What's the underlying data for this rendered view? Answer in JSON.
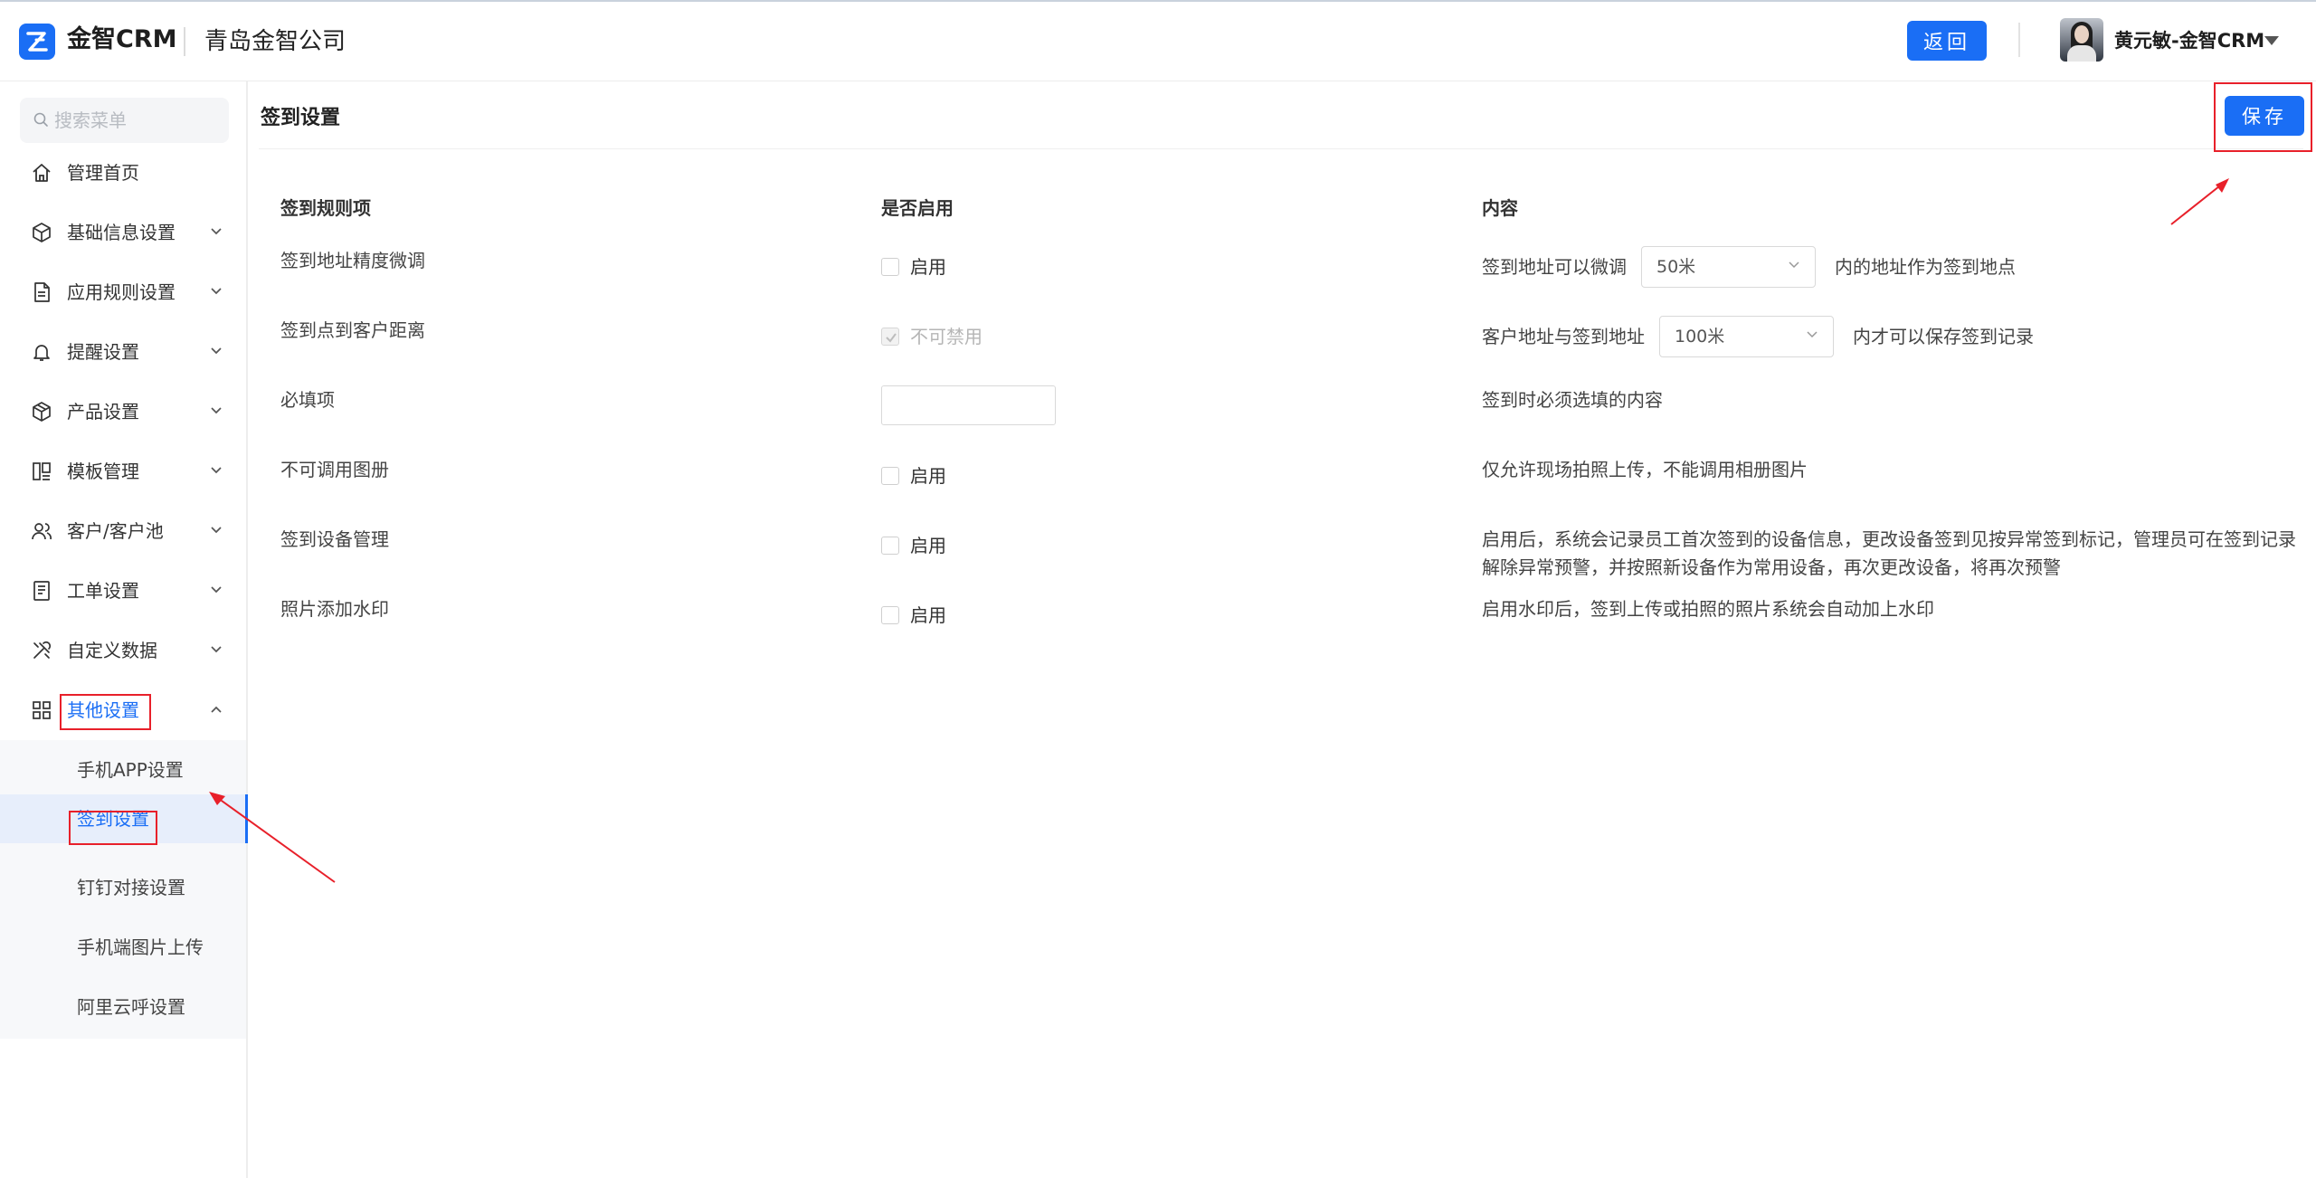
{
  "header": {
    "brand": "金智CRM",
    "company": "青岛金智公司",
    "back_label": "返回",
    "user_name": "黄元敏-金智CRM"
  },
  "sidebar": {
    "search_placeholder": "搜索菜单",
    "items": [
      {
        "label": "管理首页",
        "icon": "home-icon"
      },
      {
        "label": "基础信息设置",
        "icon": "cube-icon"
      },
      {
        "label": "应用规则设置",
        "icon": "document-icon"
      },
      {
        "label": "提醒设置",
        "icon": "bell-icon"
      },
      {
        "label": "产品设置",
        "icon": "box-icon"
      },
      {
        "label": "模板管理",
        "icon": "template-icon"
      },
      {
        "label": "客户/客户池",
        "icon": "users-icon"
      },
      {
        "label": "工单设置",
        "icon": "ticket-icon"
      },
      {
        "label": "自定义数据",
        "icon": "tools-icon"
      },
      {
        "label": "其他设置",
        "icon": "grid-icon"
      }
    ],
    "subitems": [
      {
        "label": "手机APP设置"
      },
      {
        "label": "签到设置"
      },
      {
        "label": "钉钉对接设置"
      },
      {
        "label": "手机端图片上传"
      },
      {
        "label": "阿里云呼设置"
      }
    ]
  },
  "main": {
    "title": "签到设置",
    "save_label": "保存",
    "columns": {
      "rule": "签到规则项",
      "enabled": "是否启用",
      "content": "内容"
    },
    "rows": [
      {
        "rule": "签到地址精度微调",
        "toggle": "启用",
        "content_prefix": "签到地址可以微调",
        "select_value": "50米",
        "content_suffix": "内的地址作为签到地点"
      },
      {
        "rule": "签到点到客户距离",
        "toggle": "不可禁用",
        "content_prefix": "客户地址与签到地址",
        "select_value": "100米",
        "content_suffix": "内才可以保存签到记录"
      },
      {
        "rule": "必填项",
        "content": "签到时必须选填的内容"
      },
      {
        "rule": "不可调用图册",
        "toggle": "启用",
        "content": "仅允许现场拍照上传，不能调用相册图片"
      },
      {
        "rule": "签到设备管理",
        "toggle": "启用",
        "content_line1": "启用后，系统会记录员工首次签到的设备信息，更改设备签到见按异常签到标记，管理员可在签到记录",
        "content_line2": "解除异常预警，并按照新设备作为常用设备，再次更改设备，将再次预警"
      },
      {
        "rule": "照片添加水印",
        "toggle": "启用",
        "content": "启用水印后，签到上传或拍照的照片系统会自动加上水印"
      }
    ]
  },
  "colors": {
    "primary": "#1a6ef5",
    "annotation": "#e8202a"
  }
}
